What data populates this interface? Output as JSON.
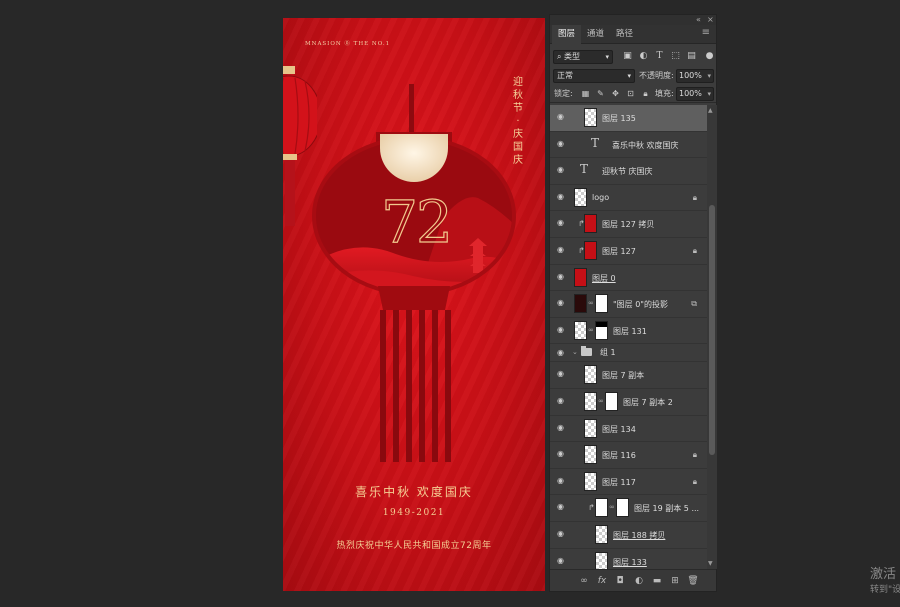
{
  "poster": {
    "brand": "MNASION ⓪ THE NO.1",
    "side_title": [
      "迎",
      "秋",
      "节",
      "·",
      "庆",
      "国",
      "庆"
    ],
    "number": "72",
    "subtitle": "喜乐中秋  欢度国庆",
    "years": "1949-2021",
    "tagline": "热烈庆祝中华人民共和国成立72周年",
    "colors": {
      "background": "#c70f16",
      "gold": "#f4cf94",
      "dark_red": "#8a0a0e"
    }
  },
  "panel": {
    "tabs": [
      "图层",
      "通道",
      "路径"
    ],
    "active_tab": "图层",
    "filter": {
      "kind": "类型"
    },
    "blend": {
      "mode": "正常",
      "opacity_label": "不透明度:",
      "opacity": "100%"
    },
    "lock": {
      "label": "锁定:",
      "fill_label": "填充:",
      "fill": "100%"
    },
    "layers": [
      {
        "name": "图层 135",
        "type": "pixel",
        "selected": true
      },
      {
        "name": "喜乐中秋  欢度国庆",
        "type": "text"
      },
      {
        "name": "迎秋节  庆国庆",
        "type": "text"
      },
      {
        "name": "logo",
        "type": "pixel",
        "locked": true
      },
      {
        "name": "图层 127 拷贝",
        "type": "pixel",
        "clipped": true
      },
      {
        "name": "图层 127",
        "type": "pixel",
        "clipped": true,
        "locked": true
      },
      {
        "name": "图层 0",
        "type": "pixel",
        "underline": true
      },
      {
        "name": "\"图层 0\"的投影",
        "type": "masked",
        "linked": true
      },
      {
        "name": "图层 131",
        "type": "masked",
        "linked": true
      },
      {
        "name": "组 1",
        "type": "group"
      },
      {
        "name": "图层 7 副本",
        "type": "pixel"
      },
      {
        "name": "图层 7 副本 2",
        "type": "masked"
      },
      {
        "name": "图层 134",
        "type": "pixel"
      },
      {
        "name": "图层 116",
        "type": "pixel",
        "locked": true
      },
      {
        "name": "图层 117",
        "type": "pixel",
        "locked": true
      },
      {
        "name": "图层 19 副本 5 ...",
        "type": "masked",
        "clipped": true
      },
      {
        "name": "图层 188 拷贝",
        "type": "pixel",
        "underline": true
      },
      {
        "name": "图层 133",
        "type": "pixel",
        "underline": true
      }
    ],
    "bottom_icons": [
      "link-icon",
      "fx-icon",
      "mask-icon",
      "adjustment-icon",
      "folder-icon",
      "new-layer-icon",
      "trash-icon"
    ],
    "fx_label": "fx"
  },
  "watermark": {
    "line1": "激活",
    "line2": "转到\"设"
  }
}
